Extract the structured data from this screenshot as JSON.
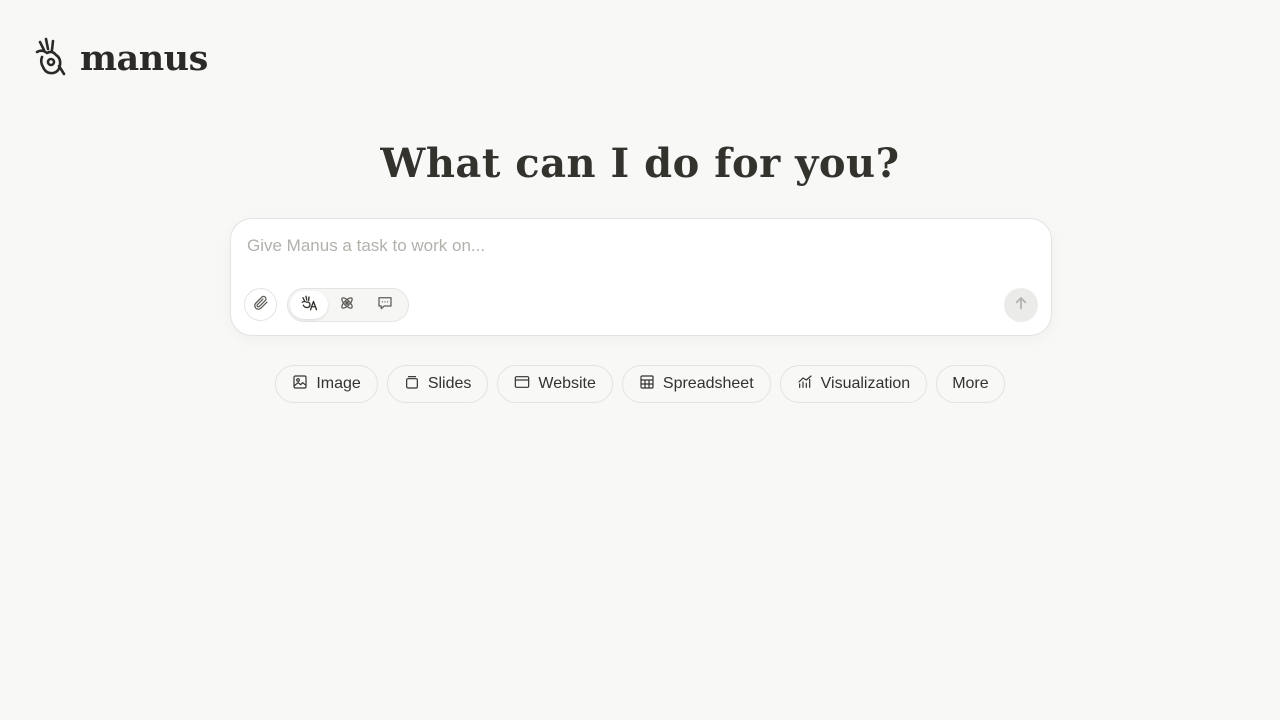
{
  "brand": {
    "name": "manus",
    "logo_icon": "manus-hand-icon"
  },
  "headline": "What can I do for you?",
  "composer": {
    "placeholder": "Give Manus a task to work on...",
    "value": "",
    "attach_icon": "paperclip-icon",
    "modes": [
      {
        "icon": "agent-mode-icon",
        "active": true
      },
      {
        "icon": "atom-icon",
        "active": false
      },
      {
        "icon": "chat-bubble-icon",
        "active": false
      }
    ],
    "send_icon": "arrow-up-icon"
  },
  "quick_actions": [
    {
      "label": "Image",
      "icon": "image-icon"
    },
    {
      "label": "Slides",
      "icon": "slides-icon"
    },
    {
      "label": "Website",
      "icon": "browser-window-icon"
    },
    {
      "label": "Spreadsheet",
      "icon": "table-icon"
    },
    {
      "label": "Visualization",
      "icon": "chart-icon"
    },
    {
      "label": "More",
      "icon": ""
    }
  ],
  "colors": {
    "background": "#f8f8f7",
    "text": "#34322d",
    "border": "#e4e3e0",
    "placeholder": "#b3b1ab"
  }
}
